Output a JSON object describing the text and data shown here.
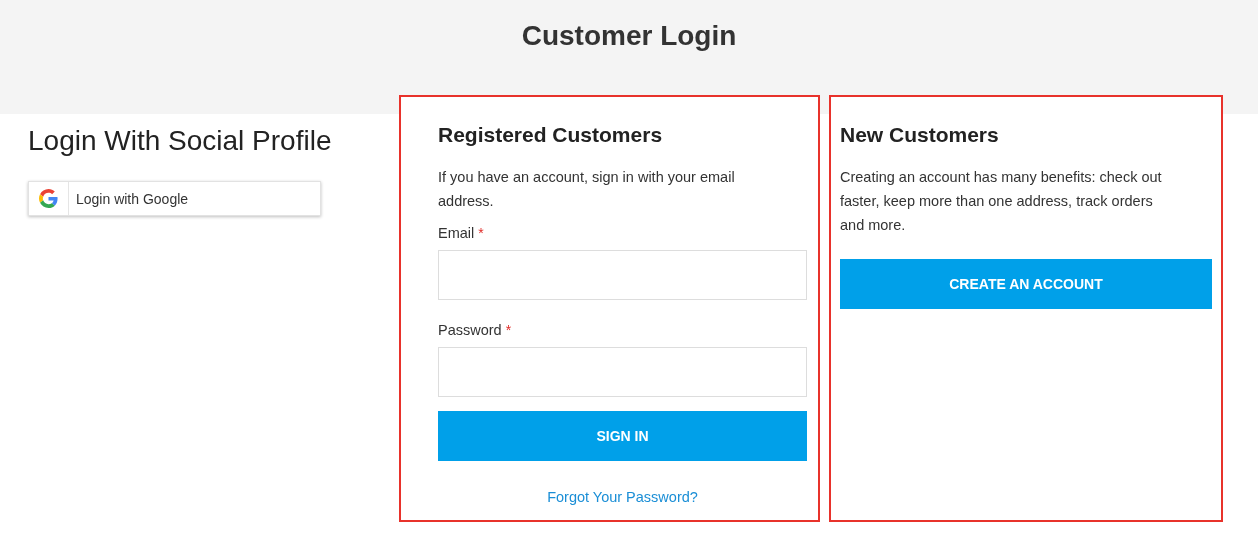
{
  "page_title": "Customer Login",
  "social": {
    "heading": "Login With Social Profile",
    "buttons": [
      {
        "kind": "google",
        "label": "Login with Google"
      }
    ]
  },
  "registered": {
    "highlighted": true,
    "heading": "Registered Customers",
    "intro": "If you have an account, sign in with your email address.",
    "fields": [
      {
        "label": "Email",
        "required_mark": "*"
      },
      {
        "label": "Password",
        "required_mark": "*"
      }
    ],
    "submit": "SIGN IN",
    "forgot_link": "Forgot Your Password?"
  },
  "new_customers": {
    "highlighted": true,
    "heading": "New Customers",
    "intro": "Creating an account has many benefits: check out faster, keep more than one address, track orders and more.",
    "button": "CREATE AN ACCOUNT"
  }
}
